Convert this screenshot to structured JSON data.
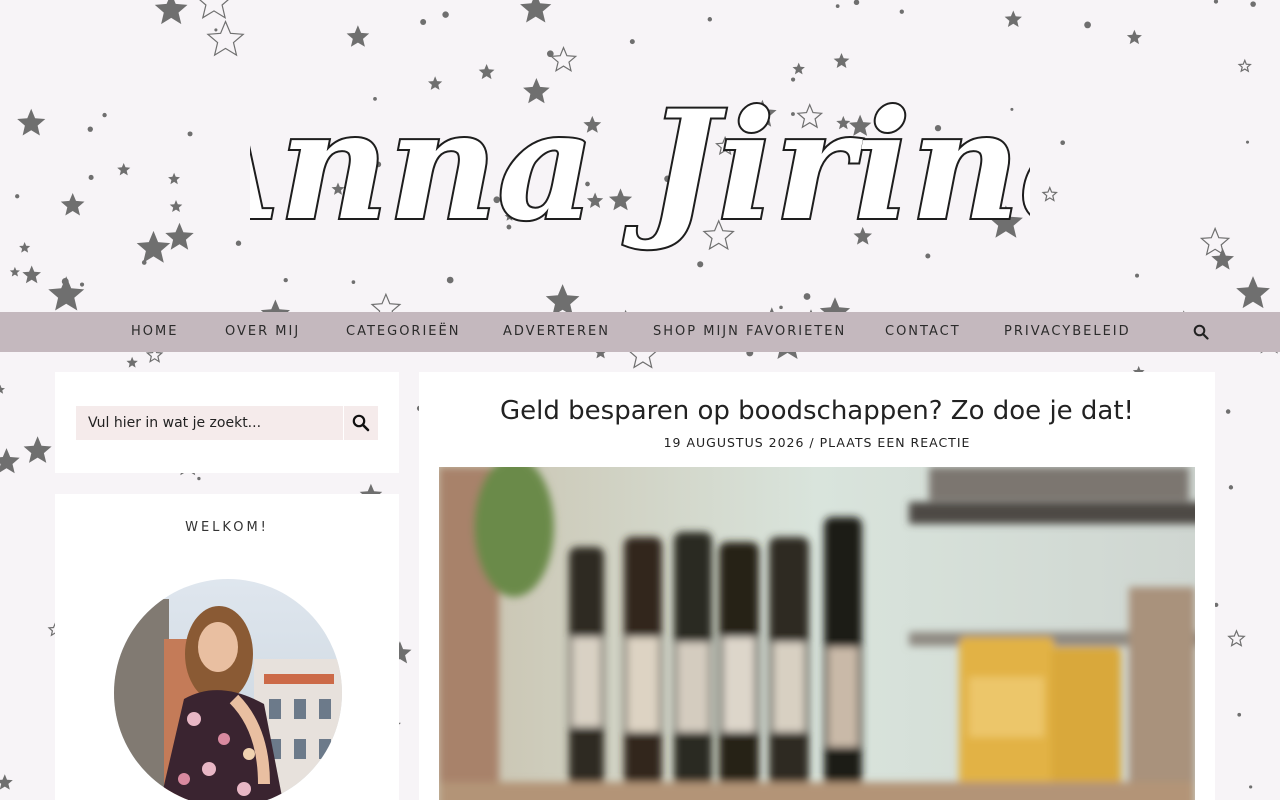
{
  "site": {
    "logo_text": "Anna Jirina"
  },
  "nav": {
    "items": [
      {
        "label": "HOME"
      },
      {
        "label": "OVER MIJ"
      },
      {
        "label": "CATEGORIEËN"
      },
      {
        "label": "ADVERTEREN"
      },
      {
        "label": "SHOP MIJN FAVORIETEN"
      },
      {
        "label": "CONTACT"
      },
      {
        "label": "PRIVACYBELEID"
      }
    ],
    "search_icon": "search-icon"
  },
  "sidebar": {
    "search": {
      "placeholder": "Vul hier in wat je zoekt...",
      "button_icon": "search-icon"
    },
    "welcome": {
      "title": "WELKOM!"
    }
  },
  "article": {
    "title": "Geld besparen op boodschappen? Zo doe je dat!",
    "date": "19 AUGUSTUS 2026",
    "separator": " / ",
    "comment_link": "PLAATS EEN REACTIE"
  },
  "colors": {
    "page_bg": "#f7f4f7",
    "nav_bg": "#c4b8be",
    "star": "#6f6f6f",
    "search_bg": "#f5ebeb",
    "text": "#222222"
  }
}
